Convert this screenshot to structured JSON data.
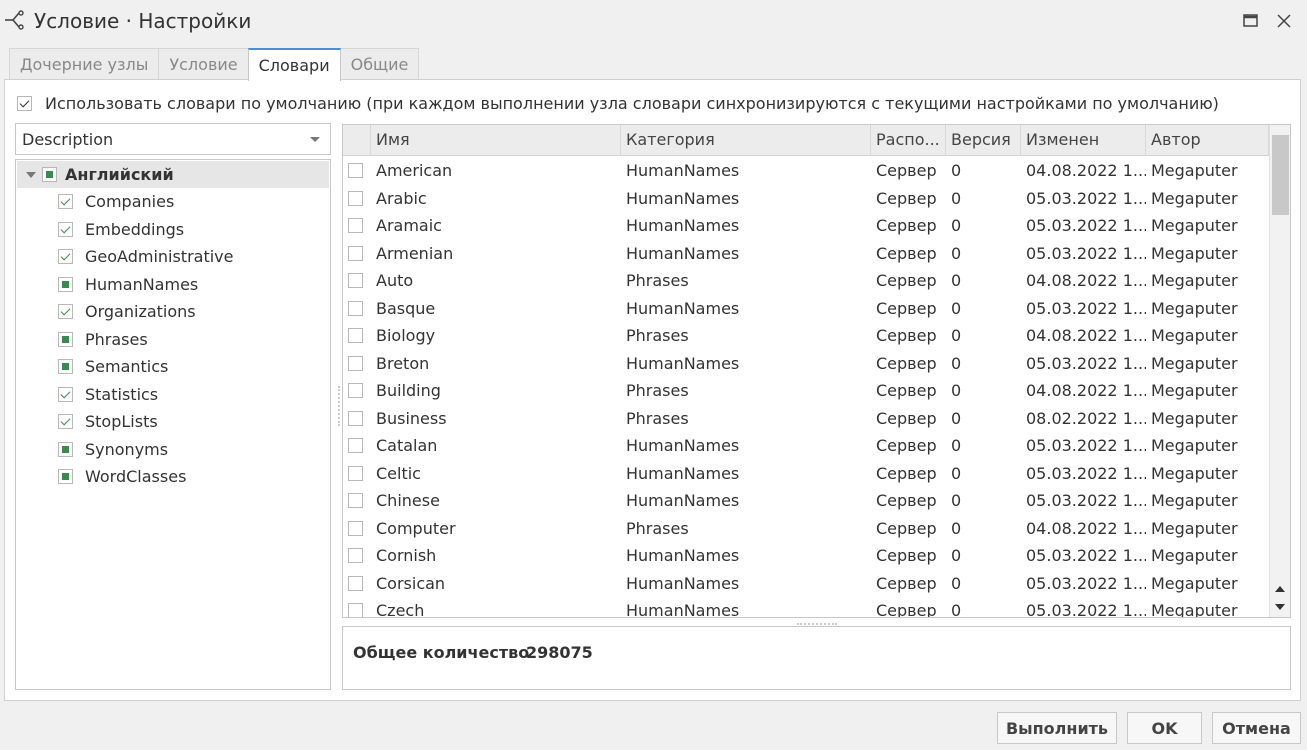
{
  "window": {
    "title": "Условие · Настройки"
  },
  "tabs": [
    {
      "label": "Дочерние узлы",
      "active": false
    },
    {
      "label": "Условие",
      "active": false
    },
    {
      "label": "Словари",
      "active": true
    },
    {
      "label": "Общие",
      "active": false
    }
  ],
  "defaults": {
    "checked": true,
    "label": "Использовать словари по умолчанию (при каждом выполнении узла словари синхронизируются с текущими настройками по умолчанию)"
  },
  "filter": {
    "selected": "Description"
  },
  "tree": {
    "root": {
      "label": "Английский",
      "state": "partial"
    },
    "items": [
      {
        "label": "Companies",
        "state": "checked"
      },
      {
        "label": "Embeddings",
        "state": "checked"
      },
      {
        "label": "GeoAdministrative",
        "state": "checked"
      },
      {
        "label": "HumanNames",
        "state": "partial"
      },
      {
        "label": "Organizations",
        "state": "checked"
      },
      {
        "label": "Phrases",
        "state": "partial"
      },
      {
        "label": "Semantics",
        "state": "partial"
      },
      {
        "label": "Statistics",
        "state": "checked"
      },
      {
        "label": "StopLists",
        "state": "checked"
      },
      {
        "label": "Synonyms",
        "state": "partial"
      },
      {
        "label": "WordClasses",
        "state": "partial"
      }
    ]
  },
  "grid": {
    "columns": [
      "Имя",
      "Категория",
      "Распо...",
      "Версия",
      "Изменен",
      "Автор"
    ],
    "rows": [
      [
        "American",
        "HumanNames",
        "Сервер",
        "0",
        "04.08.2022 1...",
        "Megaputer"
      ],
      [
        "Arabic",
        "HumanNames",
        "Сервер",
        "0",
        "05.03.2022 1...",
        "Megaputer"
      ],
      [
        "Aramaic",
        "HumanNames",
        "Сервер",
        "0",
        "05.03.2022 1...",
        "Megaputer"
      ],
      [
        "Armenian",
        "HumanNames",
        "Сервер",
        "0",
        "05.03.2022 1...",
        "Megaputer"
      ],
      [
        "Auto",
        "Phrases",
        "Сервер",
        "0",
        "04.08.2022 1...",
        "Megaputer"
      ],
      [
        "Basque",
        "HumanNames",
        "Сервер",
        "0",
        "05.03.2022 1...",
        "Megaputer"
      ],
      [
        "Biology",
        "Phrases",
        "Сервер",
        "0",
        "04.08.2022 1...",
        "Megaputer"
      ],
      [
        "Breton",
        "HumanNames",
        "Сервер",
        "0",
        "05.03.2022 1...",
        "Megaputer"
      ],
      [
        "Building",
        "Phrases",
        "Сервер",
        "0",
        "04.08.2022 1...",
        "Megaputer"
      ],
      [
        "Business",
        "Phrases",
        "Сервер",
        "0",
        "08.02.2022 1...",
        "Megaputer"
      ],
      [
        "Catalan",
        "HumanNames",
        "Сервер",
        "0",
        "05.03.2022 1...",
        "Megaputer"
      ],
      [
        "Celtic",
        "HumanNames",
        "Сервер",
        "0",
        "05.03.2022 1...",
        "Megaputer"
      ],
      [
        "Chinese",
        "HumanNames",
        "Сервер",
        "0",
        "05.03.2022 1...",
        "Megaputer"
      ],
      [
        "Computer",
        "Phrases",
        "Сервер",
        "0",
        "04.08.2022 1...",
        "Megaputer"
      ],
      [
        "Cornish",
        "HumanNames",
        "Сервер",
        "0",
        "05.03.2022 1...",
        "Megaputer"
      ],
      [
        "Corsican",
        "HumanNames",
        "Сервер",
        "0",
        "05.03.2022 1...",
        "Megaputer"
      ],
      [
        "Czech",
        "HumanNames",
        "Сервер",
        "0",
        "05.03.2022 1...",
        "Megaputer"
      ]
    ]
  },
  "summary": {
    "label": "Общее количество",
    "value": "298075"
  },
  "buttons": {
    "run": "Выполнить",
    "ok": "OK",
    "cancel": "Отмена"
  }
}
